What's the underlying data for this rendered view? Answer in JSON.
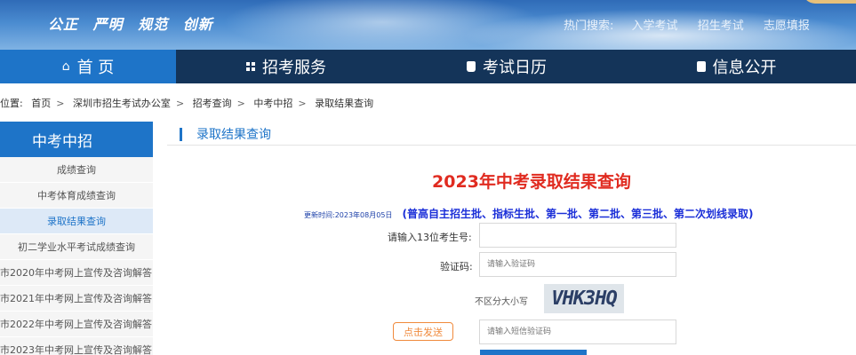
{
  "banner": {
    "slogan": [
      "公正",
      "严明",
      "规范",
      "创新"
    ],
    "hot_search": {
      "label": "热门搜索:",
      "links": [
        "入学考试",
        "招生考试",
        "志愿填报"
      ]
    }
  },
  "nav": {
    "items": [
      {
        "label": "首 页",
        "icon": "home-icon"
      },
      {
        "label": "招考服务",
        "icon": "grid-icon"
      },
      {
        "label": "考试日历",
        "icon": "calendar-icon"
      },
      {
        "label": "信息公开",
        "icon": "info-icon"
      }
    ]
  },
  "breadcrumb": {
    "prefix": "位置:",
    "items": [
      "首页",
      "深圳市招生考试办公室",
      "招考查询",
      "中考中招",
      "录取结果查询"
    ]
  },
  "sidebar": {
    "title": "中考中招",
    "items": [
      {
        "label": "成绩查询"
      },
      {
        "label": "中考体育成绩查询"
      },
      {
        "label": "录取结果查询"
      },
      {
        "label": "初二学业水平考试成绩查询"
      },
      {
        "label": "市2020年中考网上宣传及咨询解答"
      },
      {
        "label": "市2021年中考网上宣传及咨询解答"
      },
      {
        "label": "市2022年中考网上宣传及咨询解答"
      },
      {
        "label": "市2023年中考网上宣传及咨询解答"
      }
    ]
  },
  "content": {
    "section_title": "录取结果查询",
    "main_title": "2023年中考录取结果查询",
    "update_time": "更新时间:2023年08月05日",
    "update_note": "(普高自主招生批、指标生批、第一批、第二批、第三批、第二次划线录取)",
    "form": {
      "exam_no_label": "请输入13位考生号:",
      "exam_no_value": "",
      "captcha_label": "验证码:",
      "captcha_placeholder": "请输入验证码",
      "captcha_hint": "不区分大小写",
      "captcha_image_text": "VHK3HQ",
      "send_label": "点击发送",
      "sms_placeholder": "请输入短信验证码"
    }
  },
  "colors": {
    "accent": "#1e74c8",
    "nav_bg": "#143459",
    "title_red": "#e02b20",
    "send_orange": "#f08a3c"
  }
}
